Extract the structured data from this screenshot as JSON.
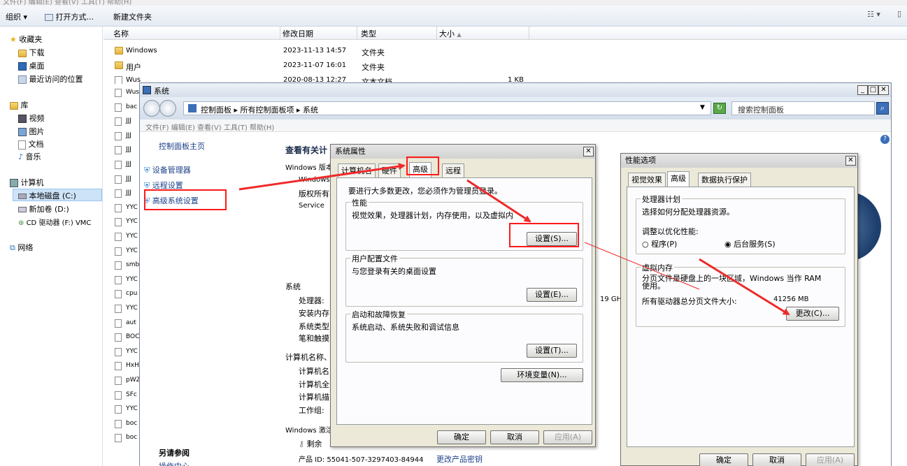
{
  "explorer": {
    "menu_top": "文件(F)  编辑(E)  查看(V)  工具(T)  帮助(H)",
    "toolbar": {
      "organize": "组织",
      "open_with": "打开方式...",
      "new_folder": "新建文件夹"
    },
    "columns": {
      "name": "名称",
      "modified": "修改日期",
      "type": "类型",
      "size": "大小"
    },
    "nav": {
      "favorites": "收藏夹",
      "fav_items": [
        "下载",
        "桌面",
        "最近访问的位置"
      ],
      "libraries": "库",
      "lib_items": [
        "视频",
        "图片",
        "文档",
        "音乐"
      ],
      "computer": "计算机",
      "drives": [
        "本地磁盘 (C:)",
        "新加卷 (D:)",
        "CD 驱动器 (F:) VMC"
      ],
      "network": "网络"
    },
    "files": [
      {
        "name": "Windows",
        "date": "2023-11-13 14:57",
        "type": "文件夹",
        "size": ""
      },
      {
        "name": "用户",
        "date": "2023-11-07 16:01",
        "type": "文件夹",
        "size": ""
      },
      {
        "name": "Wus",
        "date": "2020-08-13 12:27",
        "type": "文本文档",
        "size": "1 KB"
      }
    ],
    "partial_files": [
      "Wus",
      "bac",
      "JJJ",
      "JJJ",
      "JJJ",
      "JJJ",
      "JJJ",
      "JJJ",
      "YYC",
      "YYC",
      "YYC",
      "YYC",
      "smb",
      "YYC",
      "cpu",
      "YYC",
      "aut",
      "BOC",
      "YYC",
      "HxH",
      "pWZ",
      "SFc",
      "YYC",
      "boc",
      "boc"
    ]
  },
  "system": {
    "title": "系统",
    "breadcrumb": "控制面板 ▸ 所有控制面板项 ▸ 系统",
    "search_placeholder": "搜索控制面板",
    "menu": "文件(F)  编辑(E)  查看(V)  工具(T)  帮助(H)",
    "side": {
      "home": "控制面板主页",
      "device": "设备管理器",
      "remote": "远程设置",
      "advanced": "高级系统设置",
      "see_also": "另请参阅",
      "action_center": "操作中心"
    },
    "main": {
      "heading": "查看有关计",
      "edition": "Windows 版本",
      "win": "Windows",
      "copyright": "版权所有",
      "service": "Service",
      "system": "系统",
      "processor": "处理器:",
      "ram": "安装内存",
      "systype": "系统类型",
      "pen": "笔和触摸",
      "compname_head": "计算机名称、",
      "compname": "计算机名",
      "fullname": "计算机全",
      "desc": "计算机描",
      "workgroup": "工作组:",
      "activation": "Windows 激活",
      "remaining": "剩余",
      "product_id": "产品 ID: 55041-507-3297403-84944",
      "change_key": "更改产品密钥",
      "ghz": "19 GH"
    }
  },
  "sysprops": {
    "title": "系统属性",
    "tabs": [
      "计算机名",
      "硬件",
      "高级",
      "远程"
    ],
    "admin_note": "要进行大多数更改，您必须作为管理员登录。",
    "perf_group": "性能",
    "perf_desc": "视觉效果，处理器计划，内存使用，以及虚拟内",
    "perf_btn": "设置(S)...",
    "profile_group": "用户配置文件",
    "profile_desc": "与您登录有关的桌面设置",
    "profile_btn": "设置(E)...",
    "startup_group": "启动和故障恢复",
    "startup_desc": "系统启动、系统失败和调试信息",
    "startup_btn": "设置(T)...",
    "env_btn": "环境变量(N)...",
    "ok": "确定",
    "cancel": "取消",
    "apply": "应用(A)"
  },
  "perfopts": {
    "title": "性能选项",
    "tabs": [
      "视觉效果",
      "高级",
      "数据执行保护"
    ],
    "cpu_group": "处理器计划",
    "cpu_desc": "选择如何分配处理器资源。",
    "adjust": "调整以优化性能:",
    "opt_programs": "程序(P)",
    "opt_services": "后台服务(S)",
    "vm_group": "虚拟内存",
    "vm_desc": "分页文件是硬盘上的一块区域，Windows 当作 RAM 使用。",
    "vm_total_label": "所有驱动器总分页文件大小:",
    "vm_total": "41256 MB",
    "change_btn": "更改(C)...",
    "ok": "确定",
    "cancel": "取消",
    "apply": "应用(A)"
  },
  "colors": {
    "highlight": "#ff1a1a",
    "dialog_bg": "#ece9d8",
    "arrow": "#ee2a2a"
  }
}
